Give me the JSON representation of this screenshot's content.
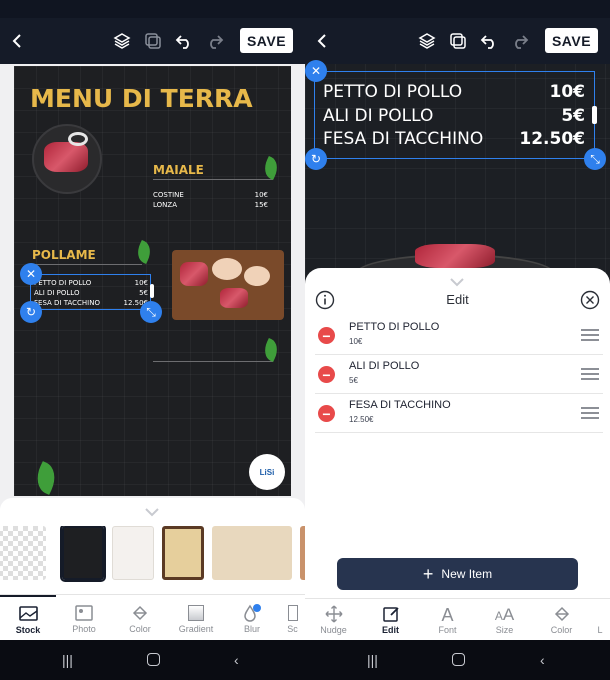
{
  "toolbar": {
    "save_label": "SAVE"
  },
  "canvas": {
    "title": "MENU DI TERRA",
    "sections": [
      {
        "name": "MAIALE",
        "items": [
          {
            "name": "COSTINE",
            "price": "10€"
          },
          {
            "name": "LONZA",
            "price": "15€"
          }
        ]
      },
      {
        "name": "POLLAME",
        "items": [
          {
            "name": "PETTO DI POLLO",
            "price": "10€"
          },
          {
            "name": "ALI DI POLLO",
            "price": "5€"
          },
          {
            "name": "FESA DI TACCHINO",
            "price": "12.50€"
          }
        ]
      }
    ],
    "logo_text": "LiSi"
  },
  "left_tools": [
    {
      "label": "Stock",
      "icon": "image-stack-icon"
    },
    {
      "label": "Photo",
      "icon": "photo-icon"
    },
    {
      "label": "Color",
      "icon": "paint-bucket-icon"
    },
    {
      "label": "Gradient",
      "icon": "gradient-icon"
    },
    {
      "label": "Blur",
      "icon": "blur-drop-icon"
    },
    {
      "label": "Sc",
      "icon": "scale-icon"
    }
  ],
  "right_tools": [
    {
      "label": "Nudge",
      "icon": "move-arrows-icon"
    },
    {
      "label": "Edit",
      "icon": "edit-icon"
    },
    {
      "label": "Font",
      "icon": "font-icon"
    },
    {
      "label": "Size",
      "icon": "text-size-icon"
    },
    {
      "label": "Color",
      "icon": "paint-bucket-icon"
    },
    {
      "label": "L",
      "icon": "layer-icon"
    }
  ],
  "edit_panel": {
    "title": "Edit",
    "items": [
      {
        "name": "PETTO DI POLLO",
        "price": "10€"
      },
      {
        "name": "ALI DI POLLO",
        "price": "5€"
      },
      {
        "name": "FESA DI TACCHINO",
        "price": "12.50€"
      }
    ],
    "new_item_label": "New Item"
  },
  "colors": {
    "accent": "#2f80ed",
    "topbar": "#151b28",
    "title_gold": "#e7b84a",
    "delete_red": "#e84a4a"
  }
}
